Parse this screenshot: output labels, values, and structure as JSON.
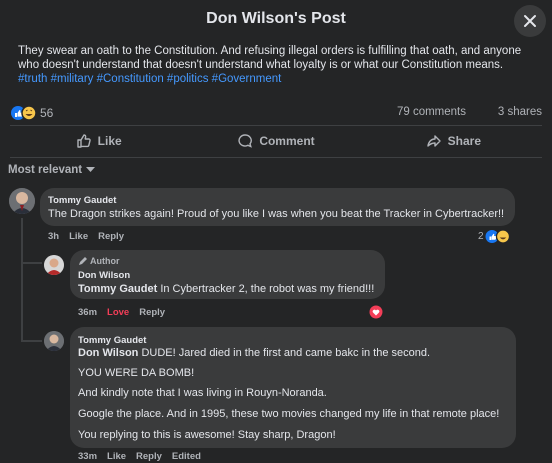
{
  "header": {
    "title": "Don Wilson's Post",
    "close_icon": "close-icon"
  },
  "post": {
    "text": "They swear an oath to the Constitution. And refusing illegal orders is fulfilling that oath, and anyone who doesn't understand that doesn't understand what loyalty is or what our Constitution means.",
    "hashtags": "#truth #military #Constitution #politics #Government"
  },
  "stats": {
    "reactions": "56",
    "comments": "79 comments",
    "shares": "3 shares"
  },
  "actions": {
    "like": "Like",
    "comment": "Comment",
    "share": "Share"
  },
  "sort": {
    "label": "Most relevant"
  },
  "comments": [
    {
      "name": "Tommy Gaudet",
      "text": "The Dragon strikes again! Proud of you like I was when you beat the Tracker in Cybertracker!!",
      "time": "3h",
      "like": "Like",
      "reply": "Reply",
      "reaction_count": "2"
    },
    {
      "badge": "Author",
      "name": "Don Wilson",
      "mention": "Tommy Gaudet",
      "text": " In Cybertracker 2, the robot was my friend!!!",
      "time": "36m",
      "love": "Love",
      "reply": "Reply"
    },
    {
      "name": "Tommy Gaudet",
      "mention": "Don Wilson",
      "line1": " DUDE! Jared died in the first and came bakc in the second.",
      "line2": "YOU WERE DA BOMB!",
      "line3": "And kindly note that I was living in Rouyn-Noranda.",
      "line4": "Google the place. And in 1995, these two movies changed my life in that remote place!",
      "line5": "You replying to this is awesome! Stay sharp, Dragon!",
      "time": "33m",
      "like": "Like",
      "reply": "Reply",
      "edited": "Edited"
    }
  ],
  "colors": {
    "background": "#242526",
    "bubble": "#3a3b3c",
    "link": "#4599ff",
    "love": "#f33e58",
    "like_blue": "#1877f2"
  }
}
